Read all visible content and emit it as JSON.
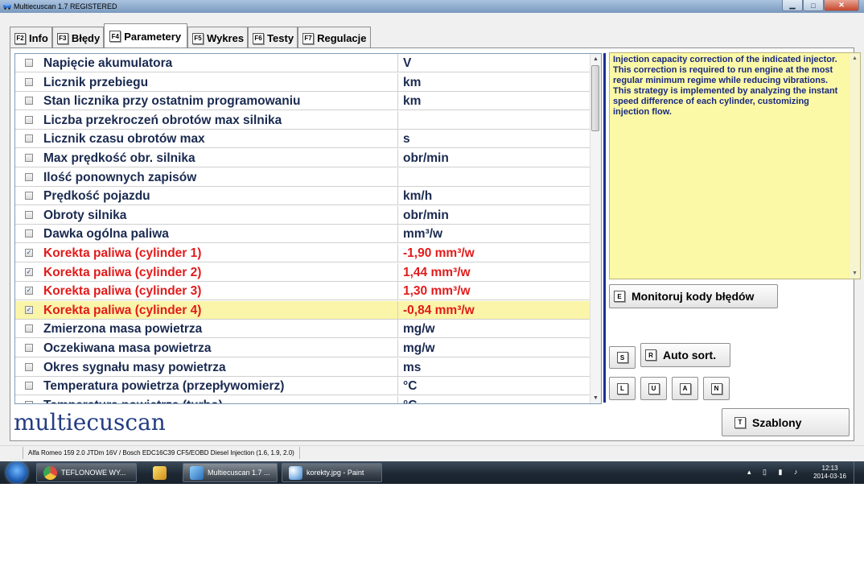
{
  "window": {
    "title": "Multiecuscan 1.7 REGISTERED"
  },
  "tabs": [
    {
      "key": "F2",
      "label": "Info"
    },
    {
      "key": "F3",
      "label": "Błędy"
    },
    {
      "key": "F4",
      "label": "Parametery",
      "active": true
    },
    {
      "key": "F5",
      "label": "Wykres"
    },
    {
      "key": "F6",
      "label": "Testy"
    },
    {
      "key": "F7",
      "label": "Regulacje"
    }
  ],
  "parameters": [
    {
      "name": "Napięcie akumulatora",
      "value": "V",
      "checked": false
    },
    {
      "name": "Licznik przebiegu",
      "value": "km",
      "checked": false
    },
    {
      "name": "Stan licznika przy ostatnim programowaniu",
      "value": "km",
      "checked": false
    },
    {
      "name": "Liczba przekroczeń obrotów max silnika",
      "value": "",
      "checked": false
    },
    {
      "name": "Licznik czasu obrotów max",
      "value": "s",
      "checked": false
    },
    {
      "name": "Max prędkość obr. silnika",
      "value": "obr/min",
      "checked": false
    },
    {
      "name": "Ilość ponownych zapisów",
      "value": "",
      "checked": false
    },
    {
      "name": "Prędkość pojazdu",
      "value": "km/h",
      "checked": false
    },
    {
      "name": "Obroty silnika",
      "value": "obr/min",
      "checked": false
    },
    {
      "name": "Dawka ogólna paliwa",
      "value": "mm³/w",
      "checked": false
    },
    {
      "name": "Korekta paliwa (cylinder 1)",
      "value": "-1,90 mm³/w",
      "checked": true,
      "highlight": "red"
    },
    {
      "name": "Korekta paliwa (cylinder 2)",
      "value": "1,44 mm³/w",
      "checked": true,
      "highlight": "red"
    },
    {
      "name": "Korekta paliwa (cylinder 3)",
      "value": "1,30 mm³/w",
      "checked": true,
      "highlight": "red"
    },
    {
      "name": "Korekta paliwa (cylinder 4)",
      "value": "-0,84 mm³/w",
      "checked": true,
      "highlight": "red",
      "selected": true
    },
    {
      "name": "Zmierzona masa powietrza",
      "value": "mg/w",
      "checked": false
    },
    {
      "name": "Oczekiwana masa powietrza",
      "value": "mg/w",
      "checked": false
    },
    {
      "name": "Okres sygnału masy powietrza",
      "value": "ms",
      "checked": false
    },
    {
      "name": "Temperatura powietrza (przepływomierz)",
      "value": "°C",
      "checked": false
    },
    {
      "name": "Temperatura powietrza (turbo)",
      "value": "°C",
      "checked": false
    }
  ],
  "description": "Injection capacity correction of the indicated injector. This correction is required to run engine at the most regular minimum regime while reducing vibrations.\nThis strategy is implemented by analyzing the instant speed difference of each cylinder, customizing injection flow.",
  "buttons": {
    "monitor_key": "E",
    "monitor_label": "Monitoruj kody błędów",
    "s_key": "S",
    "autosort_key": "R",
    "autosort_label": "Auto sort.",
    "l_key": "L",
    "u_key": "U",
    "a_key": "A",
    "n_key": "N",
    "templates_key": "T",
    "templates_label": "Szablony"
  },
  "logo": "multiecuscan",
  "status": "Alfa Romeo 159 2.0 JTDm 16V / Bosch EDC16C39 CF5/EOBD Diesel Injection (1.6, 1.9, 2.0)",
  "taskbar": {
    "items": [
      {
        "label": "TEFLONOWE WY...",
        "icon": "chrome-icon"
      },
      {
        "label": "",
        "icon": "pinned-app-icon"
      },
      {
        "label": "Multiecuscan 1.7 ...",
        "icon": "multiecuscan-icon"
      },
      {
        "label": "korekty.jpg - Paint",
        "icon": "paint-icon"
      }
    ],
    "time": "12:13",
    "date": "2014-03-16"
  },
  "colors": {
    "highlight_red": "#e21b1b",
    "selected_row": "#faf5a8",
    "description_bg": "#fbf8a6",
    "accent_blue": "#1b2f8f"
  }
}
